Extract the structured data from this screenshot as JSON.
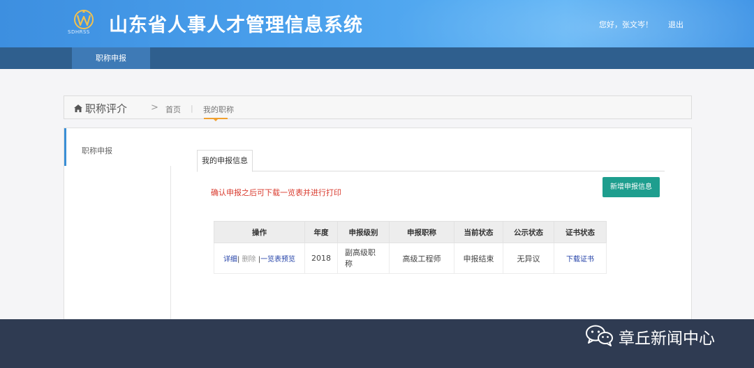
{
  "header": {
    "logo_text": "SDHRSS",
    "title": "山东省人事人才管理信息系统",
    "greeting": "您好，张文岑！",
    "logout_label": "退出"
  },
  "nav": {
    "active_tab": "职称申报"
  },
  "breadcrumb": {
    "section": "职称评介",
    "home": "首页",
    "current": "我的职称",
    "separator": ">",
    "divider": "|"
  },
  "sidebar": {
    "items": [
      {
        "label": "职称申报"
      }
    ]
  },
  "main": {
    "tab_label": "我的申报信息",
    "notice": "确认申报之后可下载一览表并进行打印",
    "add_button": "新增申报信息",
    "table": {
      "headers": [
        "操作",
        "年度",
        "申报级别",
        "申报职称",
        "当前状态",
        "公示状态",
        "证书状态"
      ],
      "rows": [
        {
          "actions": {
            "detail": "详细",
            "sep1": "|",
            "delete": "删除",
            "sep2": "|",
            "preview": "一览表预览"
          },
          "year": "2018",
          "level": "副高级职称",
          "title": "高级工程师",
          "status": "申报结束",
          "publicity": "无异议",
          "certificate": "下载证书"
        }
      ]
    }
  },
  "watermark": {
    "icon": "wechat-icon",
    "text": "章丘新闻中心"
  },
  "colors": {
    "header_blue": "#4aa0ec",
    "nav_dark": "#2f5f8e",
    "nav_active": "#3e7ab6",
    "accent_teal": "#1e9e8e",
    "notice_red": "#d93b2e",
    "link_blue": "#2442a8",
    "breadcrumb_accent": "#f0a030"
  }
}
